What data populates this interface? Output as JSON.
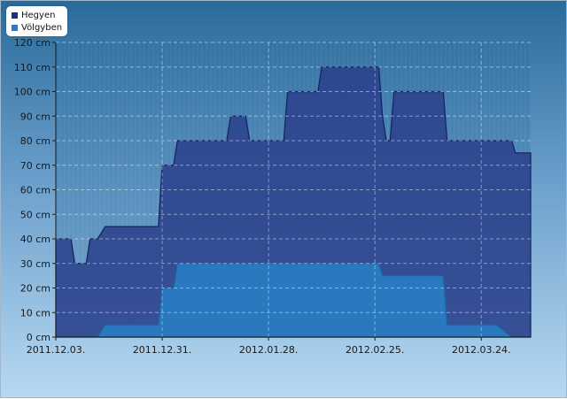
{
  "chart_data": {
    "type": "area",
    "x": [
      "2011.12.03.",
      "2011.12.07.",
      "2011.12.08.",
      "2011.12.11.",
      "2011.12.12.",
      "2011.12.14.",
      "2011.12.16.",
      "2011.12.17.",
      "2011.12.30.",
      "2011.12.31.",
      "2012.01.03.",
      "2012.01.04.",
      "2012.01.07.",
      "2012.01.17.",
      "2012.01.18.",
      "2012.01.22.",
      "2012.01.23.",
      "2012.02.01.",
      "2012.02.02.",
      "2012.02.10.",
      "2012.02.11.",
      "2012.02.19.",
      "2012.02.20.",
      "2012.02.26.",
      "2012.02.27.",
      "2012.02.28.",
      "2012.02.29.",
      "2012.03.01.",
      "2012.03.02.",
      "2012.03.03.",
      "2012.03.14.",
      "2012.03.15.",
      "2012.03.16.",
      "2012.03.28.",
      "2012.04.01.",
      "2012.04.02.",
      "2012.04.06."
    ],
    "series": [
      {
        "name": "Hegyen",
        "color": "#1c2f80",
        "values": [
          40,
          40,
          30,
          30,
          40,
          40,
          45,
          45,
          45,
          70,
          70,
          80,
          80,
          80,
          90,
          90,
          80,
          80,
          100,
          100,
          110,
          110,
          110,
          110,
          90,
          80,
          80,
          100,
          100,
          100,
          100,
          80,
          80,
          80,
          80,
          75,
          75
        ]
      },
      {
        "name": "Völgyben",
        "color": "#2a7bc0",
        "values": [
          0,
          0,
          0,
          0,
          0,
          0,
          5,
          5,
          5,
          20,
          20,
          30,
          30,
          30,
          30,
          30,
          30,
          30,
          30,
          30,
          30,
          30,
          30,
          30,
          25,
          25,
          25,
          25,
          25,
          25,
          25,
          5,
          5,
          5,
          0,
          0,
          0
        ]
      }
    ],
    "x_ticks": [
      "2011.12.03.",
      "2011.12.31.",
      "2012.01.28.",
      "2012.02.25.",
      "2012.03.24."
    ],
    "y_ticks": [
      "0 cm",
      "10 cm",
      "20 cm",
      "30 cm",
      "40 cm",
      "50 cm",
      "60 cm",
      "70 cm",
      "80 cm",
      "90 cm",
      "100 cm",
      "110 cm",
      "120 cm"
    ],
    "xlim": [
      "2011.12.03.",
      "2012.04.06."
    ],
    "ylim": [
      0,
      120
    ],
    "grid": true,
    "legend_position": "top-left"
  }
}
